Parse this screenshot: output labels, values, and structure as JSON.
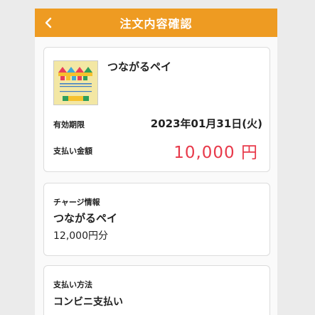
{
  "header": {
    "title": "注文内容確認",
    "back_icon": "chevron-left-icon"
  },
  "product": {
    "name": "つながるペイ",
    "logo_lines": [
      "土浦電子商店街",
      "長住大通り商店街"
    ],
    "expiry_label": "有効期限",
    "expiry_value": "2023年01月31日(火)",
    "amount_label": "支払い金額",
    "amount_value": "10,000 円"
  },
  "charge": {
    "label": "チャージ情報",
    "name": "つながるペイ",
    "amount": "12,000円分"
  },
  "payment": {
    "label": "支払い方法",
    "method": "コンビニ支払い"
  },
  "colors": {
    "header": "#ee9b22",
    "amount": "#e8394a",
    "background": "#ebebeb"
  }
}
